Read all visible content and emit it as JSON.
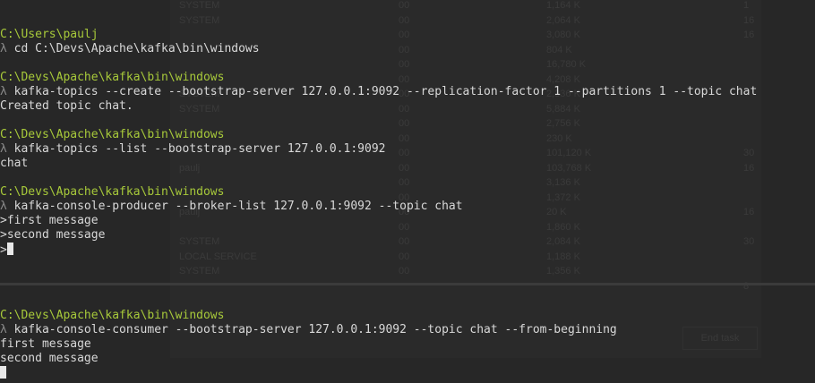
{
  "background_window": {
    "rows": [
      [
        "SYSTEM",
        "00",
        "1,164 K",
        "1"
      ],
      [
        "SYSTEM",
        "00",
        "2,064 K",
        "16"
      ],
      [
        "",
        "00",
        "3,080 K",
        "16"
      ],
      [
        "",
        "00",
        "804 K",
        ""
      ],
      [
        "",
        "00",
        "16,780 K",
        ""
      ],
      [
        "",
        "00",
        "4,208 K",
        ""
      ],
      [
        "SYSTEM",
        "00",
        "2,336 K",
        ""
      ],
      [
        "SYSTEM",
        "00",
        "5,884 K",
        ""
      ],
      [
        "",
        "00",
        "2,756 K",
        ""
      ],
      [
        "",
        "00",
        "230 K",
        ""
      ],
      [
        "",
        "00",
        "101,120 K",
        "30"
      ],
      [
        "paulj",
        "00",
        "103,768 K",
        "16"
      ],
      [
        "",
        "00",
        "3,136 K",
        ""
      ],
      [
        "",
        "00",
        "1,372 K",
        ""
      ],
      [
        "paulj",
        "00",
        "20 K",
        "16"
      ],
      [
        "",
        "00",
        "1,860 K",
        ""
      ],
      [
        "SYSTEM",
        "00",
        "2,084 K",
        "30"
      ],
      [
        "LOCAL SERVICE",
        "00",
        "1,188 K",
        ""
      ],
      [
        "SYSTEM",
        "00",
        "1,356 K",
        ""
      ],
      [
        "",
        "",
        "",
        "8"
      ]
    ],
    "button_label": "End task"
  },
  "terminal": {
    "top_lines": [
      {
        "path": "C:\\Users\\paulj"
      },
      {
        "lambda": "λ",
        "cmd": " cd C:\\Devs\\Apache\\kafka\\bin\\windows"
      },
      {
        "text": ""
      },
      {
        "path": "C:\\Devs\\Apache\\kafka\\bin\\windows"
      },
      {
        "lambda": "λ",
        "cmd": " kafka-topics --create --bootstrap-server 127.0.0.1:9092 --replication-factor 1 --partitions 1 --topic chat"
      },
      {
        "text": "Created topic chat."
      },
      {
        "text": ""
      },
      {
        "path": "C:\\Devs\\Apache\\kafka\\bin\\windows"
      },
      {
        "lambda": "λ",
        "cmd": " kafka-topics --list --bootstrap-server 127.0.0.1:9092"
      },
      {
        "text": "chat"
      },
      {
        "text": ""
      },
      {
        "path": "C:\\Devs\\Apache\\kafka\\bin\\windows"
      },
      {
        "lambda": "λ",
        "cmd": " kafka-console-producer --broker-list 127.0.0.1:9092 --topic chat"
      },
      {
        "text": ">first message"
      },
      {
        "text": ">second message"
      },
      {
        "prompt": ">",
        "cursor": true
      }
    ],
    "bottom_lines": [
      {
        "path": "C:\\Devs\\Apache\\kafka\\bin\\windows"
      },
      {
        "lambda": "λ",
        "cmd": " kafka-console-consumer --bootstrap-server 127.0.0.1:9092 --topic chat --from-beginning"
      },
      {
        "text": "first message"
      },
      {
        "text": "second message"
      },
      {
        "prompt": "",
        "cursor": true
      }
    ],
    "colors": {
      "background": "#272727",
      "path": "#a7c93a",
      "text": "#d8d8d8",
      "lambda": "#8a8a8a"
    }
  }
}
